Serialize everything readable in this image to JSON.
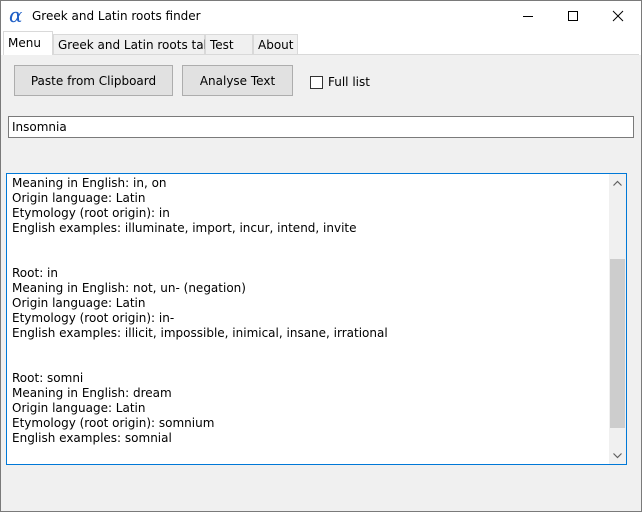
{
  "window": {
    "title": "Greek and Latin roots finder",
    "icon": "alpha-icon",
    "icon_glyph": "α",
    "icon_color": "#1f5fc6"
  },
  "tabs": [
    {
      "label": "Menu",
      "active": true
    },
    {
      "label": "Greek and Latin roots table",
      "active": false
    },
    {
      "label": "Test",
      "active": false
    },
    {
      "label": "About",
      "active": false
    }
  ],
  "toolbar": {
    "paste_label": "Paste from Clipboard",
    "analyse_label": "Analyse Text",
    "full_list_label": "Full list",
    "full_list_checked": false
  },
  "input": {
    "value": "Insomnia"
  },
  "output": {
    "lines": [
      "Meaning in English: in, on",
      "Origin language: Latin",
      "Etymology (root origin): in",
      "English examples: illuminate, import, incur, intend, invite",
      "",
      "",
      "Root: in",
      "Meaning in English: not, un- (negation)",
      "Origin language: Latin",
      "Etymology (root origin): in-",
      "English examples: illicit, impossible, inimical, insane, irrational",
      "",
      "",
      "Root: somni",
      "Meaning in English: dream",
      "Origin language: Latin",
      "Etymology (root origin): somnium",
      "English examples: somnial"
    ],
    "scroll_position_fraction": 0.55
  },
  "colors": {
    "accent": "#0078d7",
    "button_face": "#e1e1e1",
    "panel": "#f0f0f0"
  }
}
